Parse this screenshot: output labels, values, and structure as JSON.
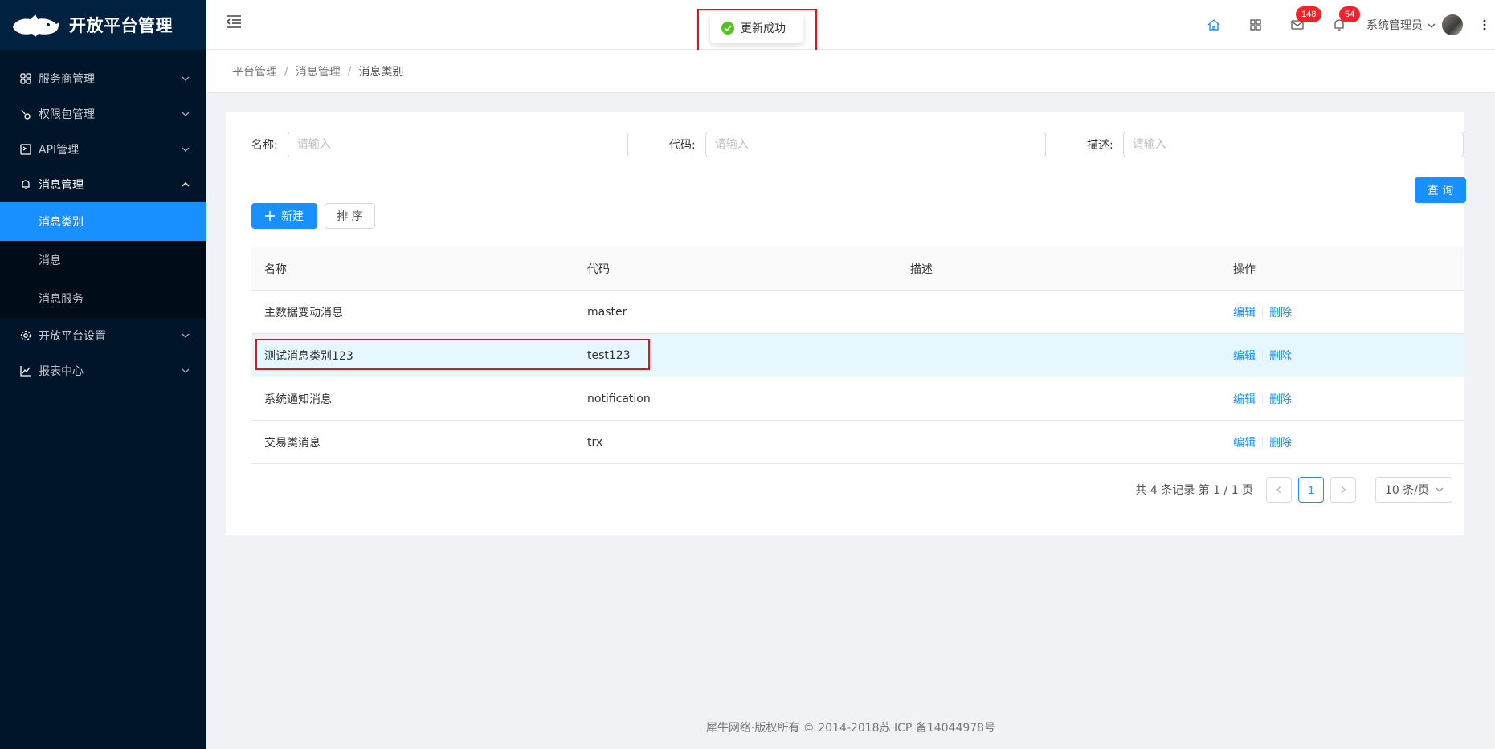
{
  "app": {
    "title": "开放平台管理"
  },
  "sidebar": {
    "items": [
      {
        "label": "服务商管理",
        "icon": "partners-icon"
      },
      {
        "label": "权限包管理",
        "icon": "permission-icon"
      },
      {
        "label": "API管理",
        "icon": "api-icon"
      },
      {
        "label": "消息管理",
        "icon": "bell-icon"
      },
      {
        "label": "开放平台设置",
        "icon": "settings-icon"
      },
      {
        "label": "报表中心",
        "icon": "chart-icon"
      }
    ],
    "submenu": [
      {
        "label": "消息类别"
      },
      {
        "label": "消息"
      },
      {
        "label": "消息服务"
      }
    ]
  },
  "header": {
    "toast": "更新成功",
    "mail_count": "148",
    "notify_count": "54",
    "user_name": "系统管理员"
  },
  "breadcrumb": [
    "平台管理",
    "/",
    "消息管理",
    "/",
    "消息类别"
  ],
  "form": {
    "name_label": "名称:",
    "code_label": "代码:",
    "desc_label": "描述:",
    "placeholder": "请输入",
    "query_button": "查 询",
    "new_button": "新建",
    "sort_button": "排 序"
  },
  "table": {
    "columns": [
      "名称",
      "代码",
      "描述",
      "操作"
    ],
    "rows": [
      {
        "name": "主数据变动消息",
        "code": "master",
        "desc": "",
        "edit": "编辑",
        "del": "删除"
      },
      {
        "name": "测试消息类别123",
        "code": "test123",
        "desc": "",
        "edit": "编辑",
        "del": "删除"
      },
      {
        "name": "系统通知消息",
        "code": "notification",
        "desc": "",
        "edit": "编辑",
        "del": "删除"
      },
      {
        "name": "交易类消息",
        "code": "trx",
        "desc": "",
        "edit": "编辑",
        "del": "删除"
      }
    ]
  },
  "pagination": {
    "summary": "共 4 条记录 第 1 / 1 页",
    "current": "1",
    "page_size": "10 条/页"
  },
  "footer": "犀牛网络·版权所有 © 2014-2018苏 ICP 备14044978号",
  "colors": {
    "sidebar_bg": "#001529",
    "accent": "#1890ff",
    "highlight_box": "#e8101a",
    "success": "#52c41a"
  }
}
